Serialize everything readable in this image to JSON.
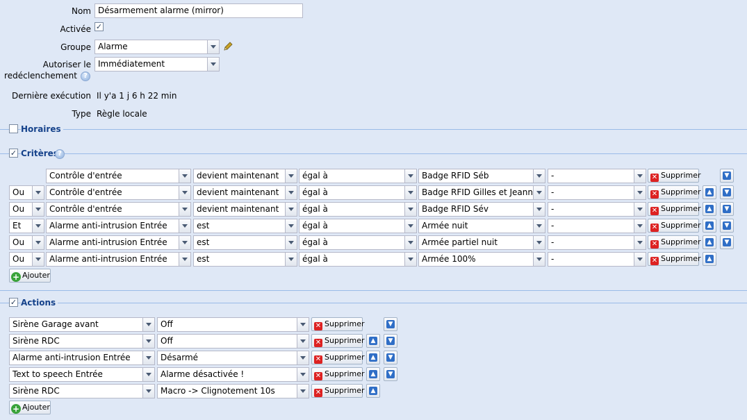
{
  "form": {
    "name_label": "Nom",
    "name_value": "Désarmement alarme (mirror)",
    "active_label": "Activée",
    "active_checked": true,
    "group_label": "Groupe",
    "group_value": "Alarme",
    "retrigger_label_1": "Autoriser le",
    "retrigger_label_2": "redéclenchement",
    "retrigger_value": "Immédiatement",
    "last_exec_label": "Dernière exécution",
    "last_exec_value": "Il y'a 1 j 6 h 22 min",
    "type_label": "Type",
    "type_value": "Règle locale"
  },
  "sections": {
    "schedules": {
      "title": "Horaires",
      "checked": false
    },
    "criteria": {
      "title": "Critères",
      "checked": true
    },
    "actions": {
      "title": "Actions",
      "checked": true
    }
  },
  "criteria_rows": [
    {
      "op": "",
      "device": "Contrôle d'entrée",
      "event": "devient maintenant",
      "cmp": "égal à",
      "value": "Badge RFID Séb",
      "extra": "-",
      "delete": "Supprimer",
      "up": false,
      "down": true
    },
    {
      "op": "Ou",
      "device": "Contrôle d'entrée",
      "event": "devient maintenant",
      "cmp": "égal à",
      "value": "Badge RFID Gilles et Jeanne",
      "extra": "-",
      "delete": "Supprimer",
      "up": true,
      "down": true
    },
    {
      "op": "Ou",
      "device": "Contrôle d'entrée",
      "event": "devient maintenant",
      "cmp": "égal à",
      "value": "Badge RFID Sév",
      "extra": "-",
      "delete": "Supprimer",
      "up": true,
      "down": true
    },
    {
      "op": "Et",
      "device": "Alarme anti-intrusion Entrée",
      "event": "est",
      "cmp": "égal à",
      "value": "Armée nuit",
      "extra": "-",
      "delete": "Supprimer",
      "up": true,
      "down": true
    },
    {
      "op": "Ou",
      "device": "Alarme anti-intrusion Entrée",
      "event": "est",
      "cmp": "égal à",
      "value": "Armée partiel nuit",
      "extra": "-",
      "delete": "Supprimer",
      "up": true,
      "down": true
    },
    {
      "op": "Ou",
      "device": "Alarme anti-intrusion Entrée",
      "event": "est",
      "cmp": "égal à",
      "value": "Armée 100%",
      "extra": "-",
      "delete": "Supprimer",
      "up": true,
      "down": false
    }
  ],
  "criteria_add": "Ajouter",
  "action_rows": [
    {
      "device": "Sirène Garage avant",
      "value": "Off",
      "delete": "Supprimer",
      "up": false,
      "down": true
    },
    {
      "device": "Sirène RDC",
      "value": "Off",
      "delete": "Supprimer",
      "up": true,
      "down": true
    },
    {
      "device": "Alarme anti-intrusion Entrée",
      "value": "Désarmé",
      "delete": "Supprimer",
      "up": true,
      "down": true
    },
    {
      "device": "Text to speech Entrée",
      "value": "Alarme désactivée !",
      "delete": "Supprimer",
      "up": true,
      "down": true
    },
    {
      "device": "Sirène RDC",
      "value": "Macro -> Clignotement 10s",
      "delete": "Supprimer",
      "up": true,
      "down": false
    }
  ],
  "actions_add": "Ajouter",
  "icons": {
    "checkbox_checked": "✓",
    "help": "?",
    "delete": "✕",
    "up": "▲",
    "down": "▼",
    "add": "+"
  },
  "colors": {
    "background": "#dfe8f6",
    "section_title": "#15428b",
    "delete_icon": "#dd2222",
    "add_icon": "#3aa33a",
    "arrow_icon": "#2f6ec6"
  }
}
